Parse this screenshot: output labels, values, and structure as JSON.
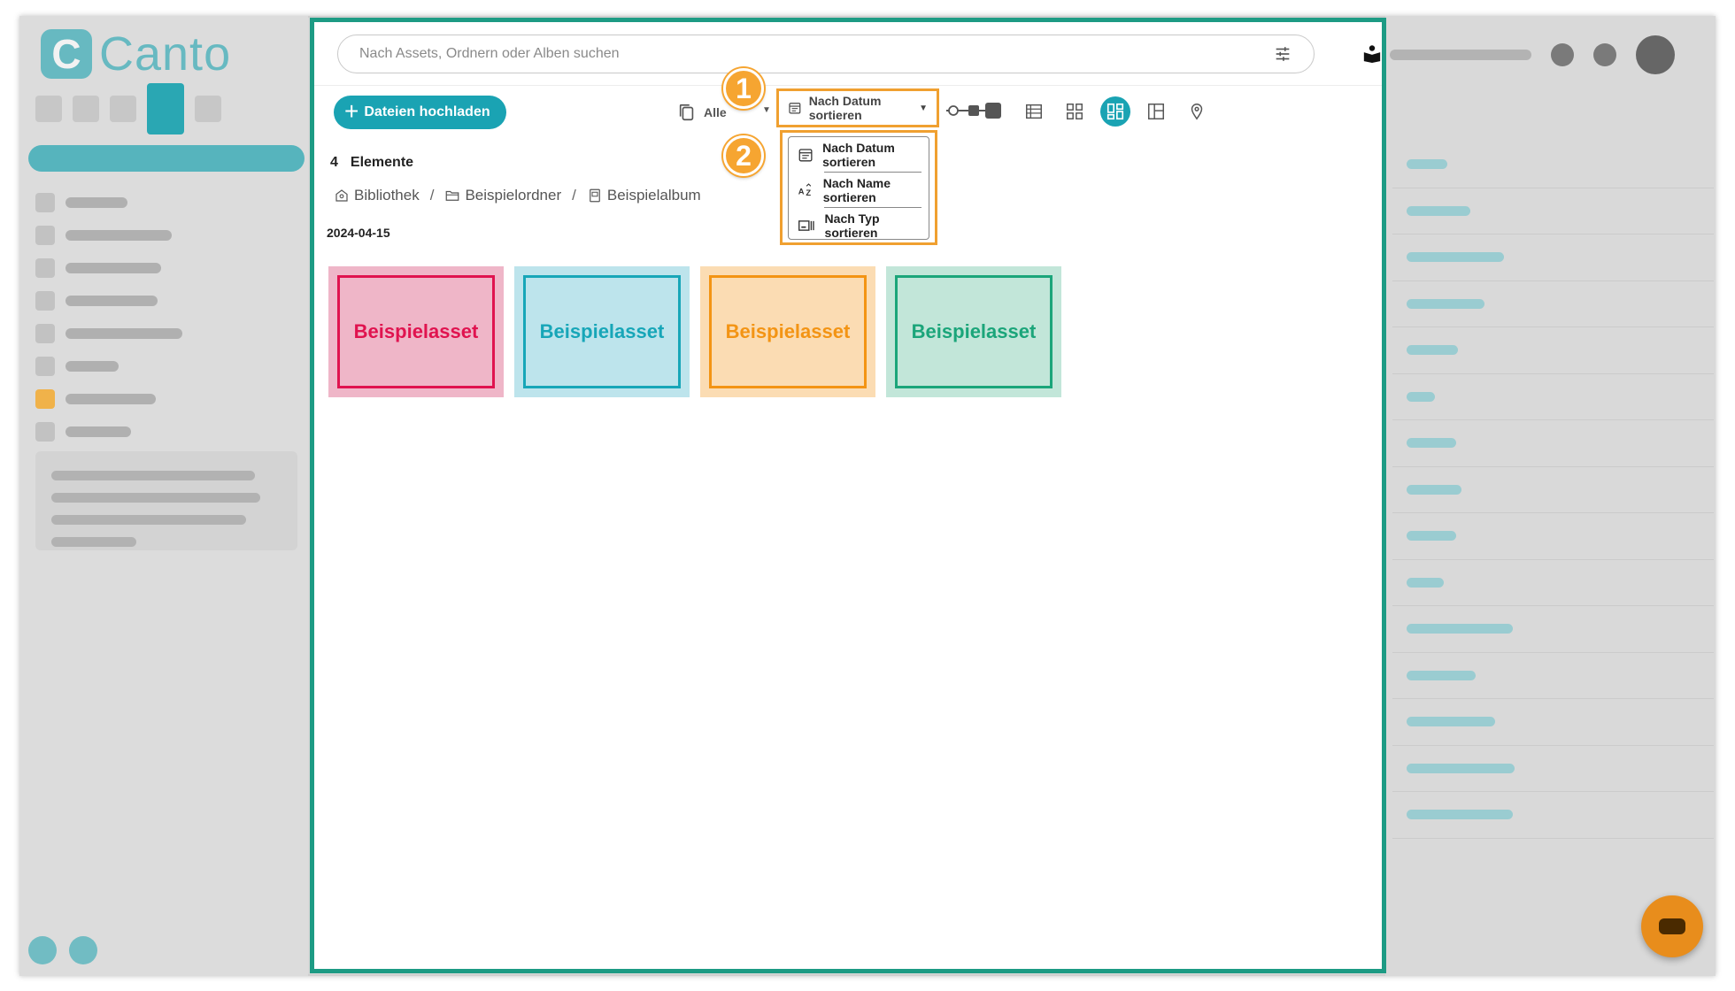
{
  "brand": {
    "name": "Canto",
    "mark": "C"
  },
  "search": {
    "placeholder": "Nach Assets, Ordnern oder Alben suchen"
  },
  "toolbar": {
    "upload_label": "Dateien hochladen",
    "filter_label": "Alle",
    "sort_label": "Nach Datum sortieren"
  },
  "callouts": [
    "1",
    "2"
  ],
  "sort_menu": {
    "items": [
      {
        "label": "Nach Datum sortieren",
        "icon": "calendar-icon"
      },
      {
        "label": "Nach Name sortieren",
        "icon": "az-sort-icon"
      },
      {
        "label": "Nach Typ sortieren",
        "icon": "type-sort-icon"
      }
    ]
  },
  "content": {
    "count": "4",
    "count_label": "Elemente",
    "breadcrumb": [
      {
        "label": "Bibliothek",
        "icon": "library-icon"
      },
      {
        "label": "Beispielordner",
        "icon": "folder-icon"
      },
      {
        "label": "Beispielalbum",
        "icon": "album-icon"
      }
    ],
    "breadcrumb_separator": "/",
    "date_group": "2024-04-15",
    "assets": [
      {
        "label": "Beispielasset",
        "bg": "#efb6c8",
        "color": "#e0134f"
      },
      {
        "label": "Beispielasset",
        "bg": "#bde4ec",
        "color": "#17a6b8"
      },
      {
        "label": "Beispielasset",
        "bg": "#fbdcb3",
        "color": "#f39414"
      },
      {
        "label": "Beispielasset",
        "bg": "#c2e6d9",
        "color": "#1ba57a"
      }
    ]
  },
  "colors": {
    "accent": "#1aa3b3",
    "highlight": "#f0a030",
    "panel_border": "#1d9b84"
  }
}
